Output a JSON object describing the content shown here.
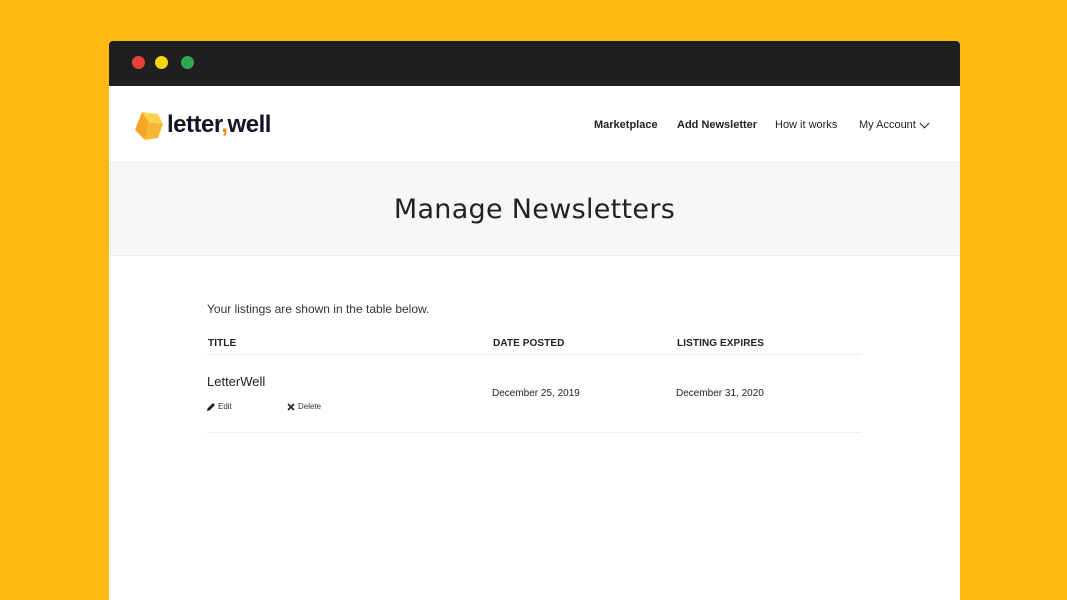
{
  "brand": {
    "logo_text_1": "letter",
    "logo_comma": ",",
    "logo_text_2": "well",
    "primary_color": "#FDB914",
    "accent_color": "#F08A1C"
  },
  "nav": {
    "marketplace": "Marketplace",
    "add_newsletter": "Add Newsletter",
    "how_it_works": "How it works",
    "my_account": "My Account"
  },
  "hero": {
    "title": "Manage Newsletters"
  },
  "main": {
    "intro": "Your listings are shown in the table below.",
    "columns": [
      "TITLE",
      "DATE POSTED",
      "LISTING EXPIRES"
    ],
    "rows": [
      {
        "title": "LetterWell",
        "date_posted": "December 25, 2019",
        "listing_expires": "December 31, 2020",
        "edit_label": "Edit",
        "delete_label": "Delete"
      }
    ]
  }
}
